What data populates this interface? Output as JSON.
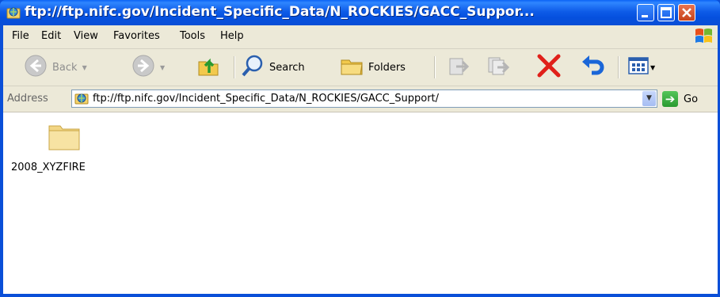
{
  "window": {
    "title": "ftp://ftp.nifc.gov/Incident_Specific_Data/N_ROCKIES/GACC_Suppor..."
  },
  "menu": [
    {
      "label": "File"
    },
    {
      "label": "Edit"
    },
    {
      "label": "View"
    },
    {
      "label": "Favorites"
    },
    {
      "label": "Tools"
    },
    {
      "label": "Help"
    }
  ],
  "toolbar": {
    "back_label": "Back",
    "search_label": "Search",
    "folders_label": "Folders"
  },
  "address": {
    "label": "Address",
    "value": "ftp://ftp.nifc.gov/Incident_Specific_Data/N_ROCKIES/GACC_Support/",
    "go_label": "Go"
  },
  "items": [
    {
      "name": "2008_XYZFIRE",
      "icon": "folder-icon"
    }
  ],
  "colors": {
    "titlebar": "#0a5ae6",
    "chrome": "#ece9d8",
    "delete_red": "#e0201a",
    "undo_blue": "#1a66d8"
  }
}
